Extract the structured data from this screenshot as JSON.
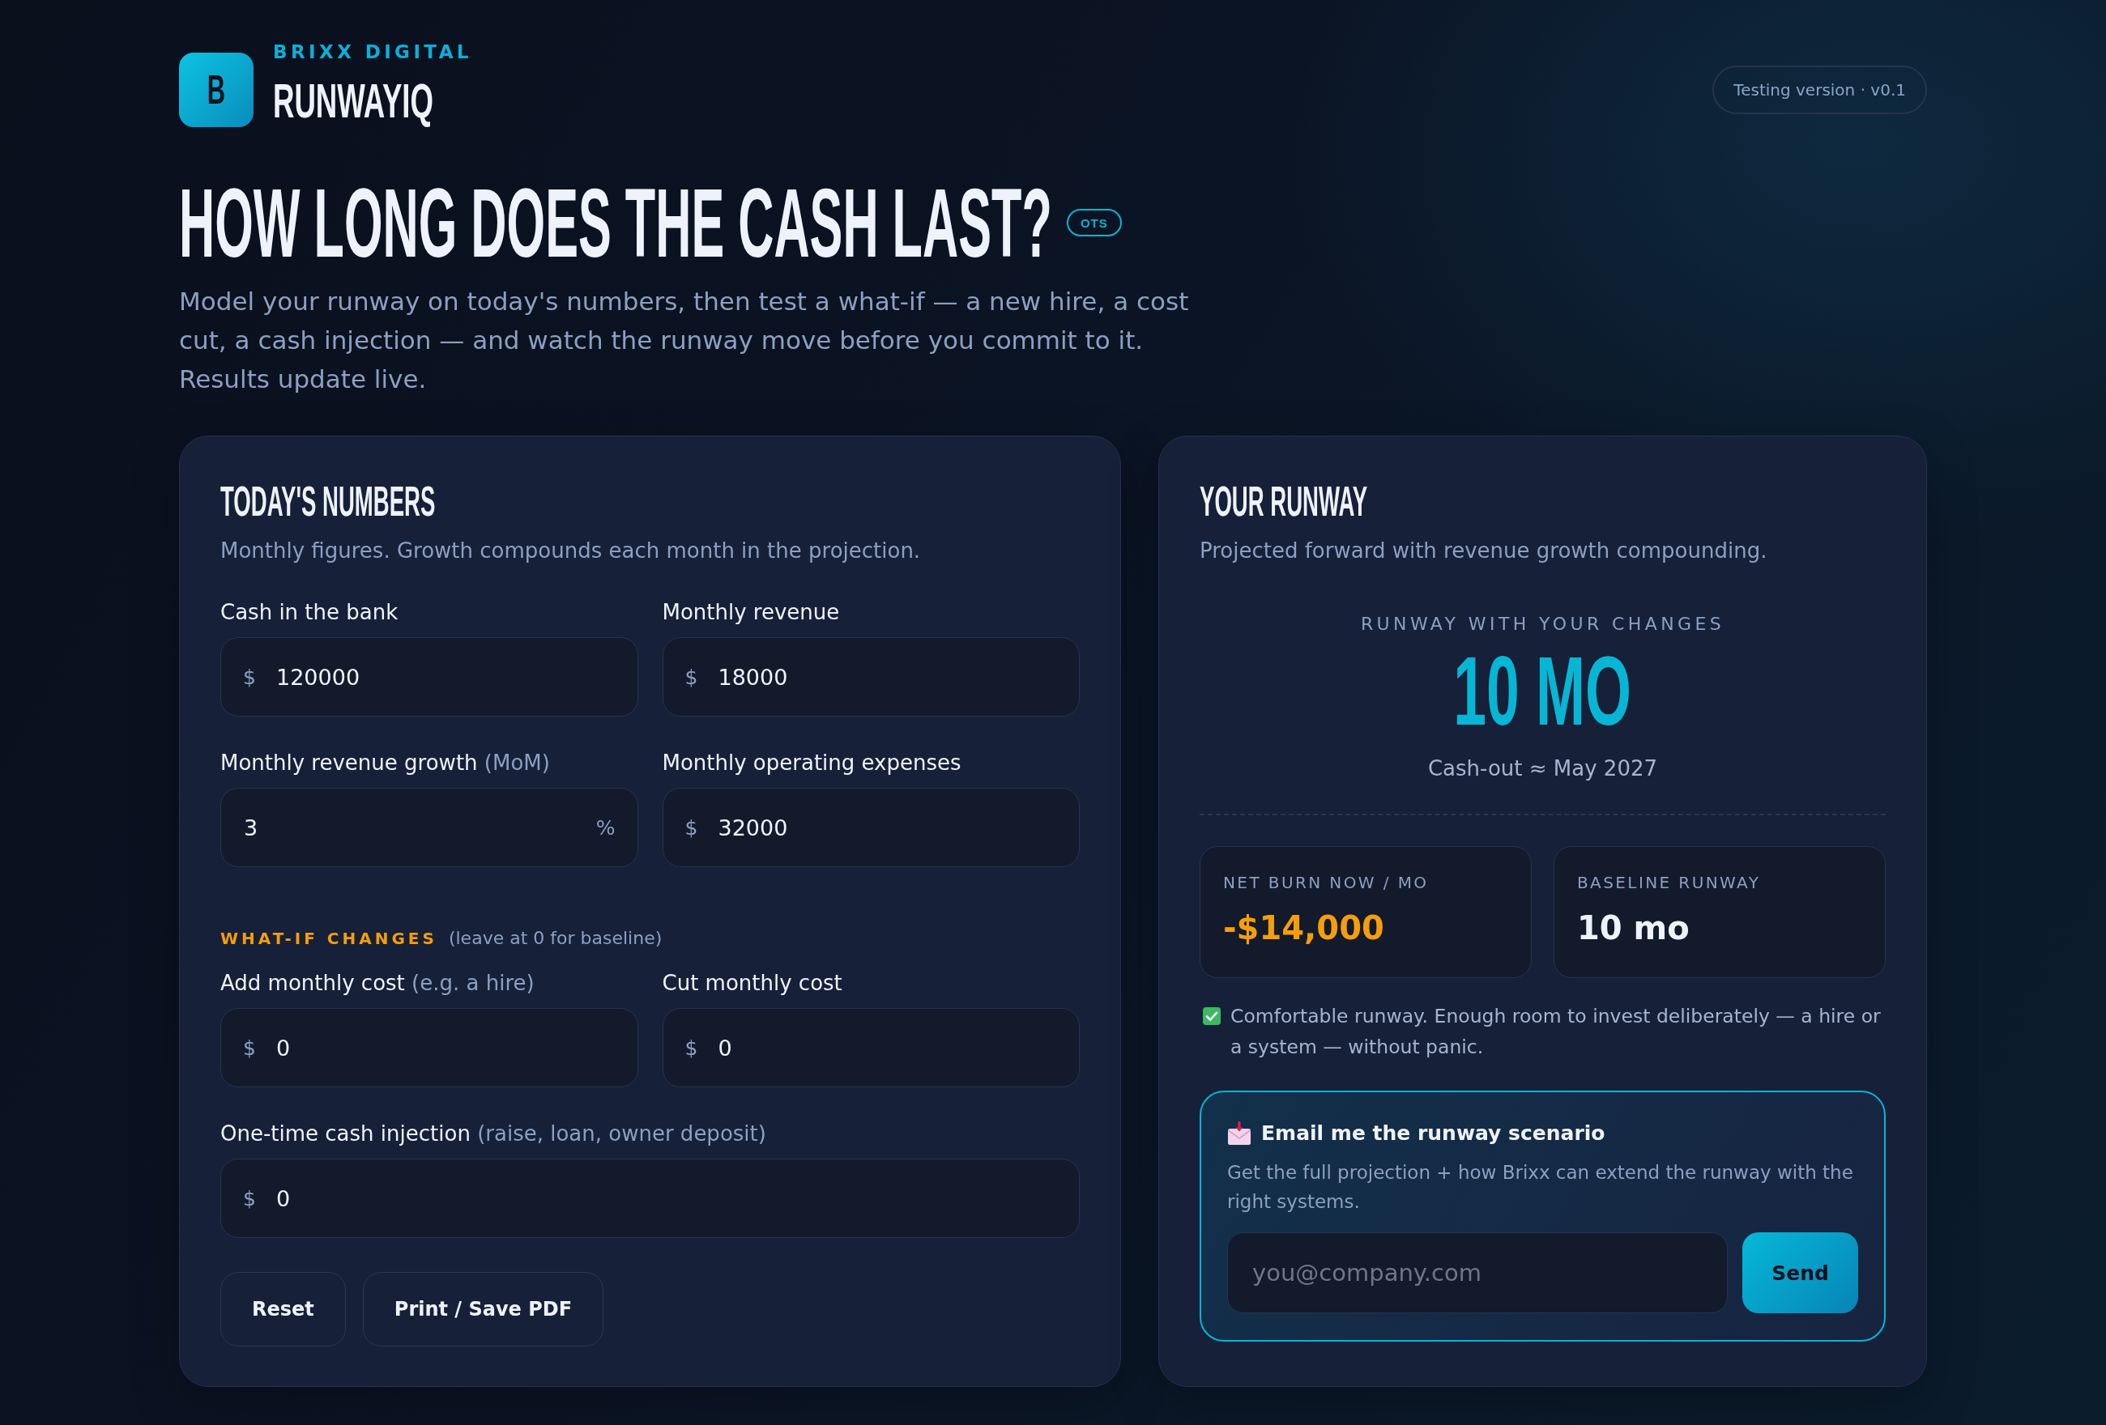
{
  "brand": {
    "logo_letter": "B",
    "company": "BRIXX DIGITAL",
    "product": "RUNWAYIQ"
  },
  "version_badge": "Testing version · v0.1",
  "hero": {
    "title": "HOW LONG DOES THE CASH LAST?",
    "tag": "OTS",
    "intro": "Model your runway on today's numbers, then test a what-if — a new hire, a cost cut, a cash injection — and watch the runway move before you commit to it. Results update live."
  },
  "inputs_panel": {
    "title": "TODAY'S NUMBERS",
    "subtitle": "Monthly figures. Growth compounds each month in the projection.",
    "rows": [
      [
        {
          "label": "Cash in the bank",
          "prefix": "$",
          "value": "120000"
        },
        {
          "label": "Monthly revenue",
          "prefix": "$",
          "value": "18000"
        }
      ],
      [
        {
          "label": "Monthly revenue growth",
          "note": "(MoM)",
          "value": "3",
          "suffix": "%"
        },
        {
          "label": "Monthly operating expenses",
          "prefix": "$",
          "value": "32000"
        }
      ]
    ],
    "what_if": {
      "title": "WHAT-IF CHANGES",
      "note": "(leave at 0 for baseline)",
      "rows": [
        [
          {
            "label": "Add monthly cost",
            "note": "(e.g. a hire)",
            "prefix": "$",
            "value": "0"
          },
          {
            "label": "Cut monthly cost",
            "prefix": "$",
            "value": "0"
          }
        ],
        [
          {
            "label": "One-time cash injection",
            "note": "(raise, loan, owner deposit)",
            "prefix": "$",
            "value": "0"
          }
        ]
      ]
    },
    "buttons": [
      "Reset",
      "Print / Save PDF"
    ]
  },
  "results_panel": {
    "title": "YOUR RUNWAY",
    "subtitle": "Projected forward with revenue growth compounding.",
    "headline": {
      "label": "RUNWAY WITH YOUR CHANGES",
      "value": "10 MO",
      "cash_out": "Cash-out ≈ May 2027"
    },
    "stats": [
      {
        "label": "NET BURN NOW / MO",
        "value": "-$14,000",
        "kind": "warning"
      },
      {
        "label": "BASELINE RUNWAY",
        "value": "10 mo",
        "kind": "normal"
      }
    ],
    "status": {
      "kind": "ok",
      "text": "Comfortable runway. Enough room to invest deliberately — a hire or a system — without panic."
    },
    "email": {
      "title": "Email me the runway scenario",
      "text": "Get the full projection + how Brixx can extend the runway with the right systems.",
      "placeholder": "you@company.com",
      "button": "Send"
    }
  }
}
